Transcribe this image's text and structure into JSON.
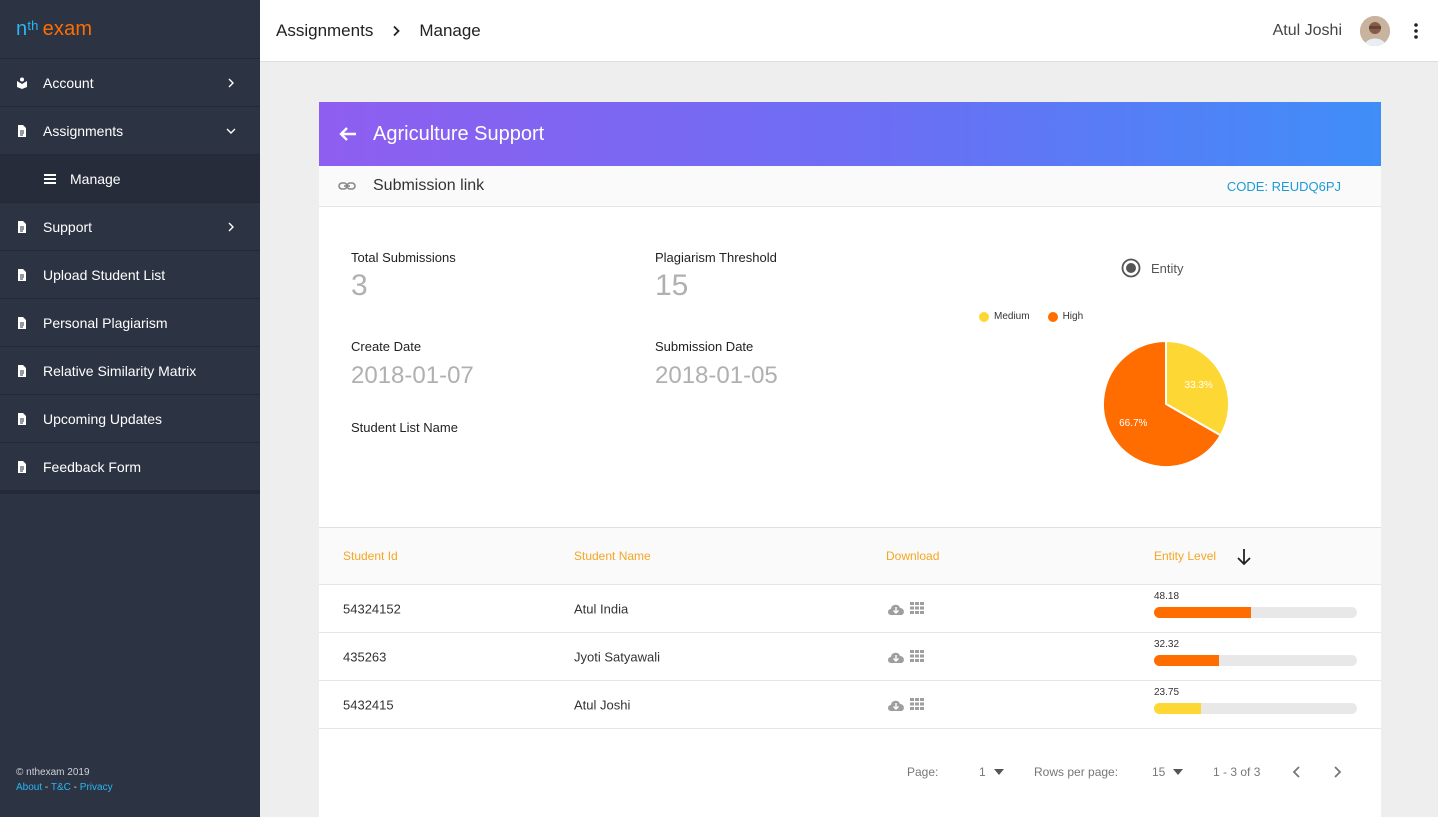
{
  "logo": {
    "n": "n",
    "th": "th",
    "exam": "exam"
  },
  "sidebar": {
    "items": [
      {
        "label": "Account"
      },
      {
        "label": "Assignments"
      },
      {
        "label": "Manage"
      },
      {
        "label": "Support"
      },
      {
        "label": "Upload Student List"
      },
      {
        "label": "Personal Plagiarism"
      },
      {
        "label": "Relative Similarity Matrix"
      },
      {
        "label": "Upcoming Updates"
      },
      {
        "label": "Feedback Form"
      }
    ],
    "footer": {
      "copyright": "© nthexam 2019",
      "about": "About",
      "tc": "T&C",
      "privacy": "Privacy",
      "sep": "-"
    }
  },
  "header": {
    "breadcrumb": [
      "Assignments",
      "Manage"
    ],
    "user_name": "Atul Joshi"
  },
  "card": {
    "title": "Agriculture Support",
    "submission_link_label": "Submission link",
    "code": "CODE: REUDQ6PJ",
    "fields": {
      "total_submissions_label": "Total Submissions",
      "total_submissions": "3",
      "threshold_label": "Plagiarism Threshold",
      "threshold": "15",
      "create_date_label": "Create Date",
      "create_date": "2018-01-07",
      "submission_date_label": "Submission Date",
      "submission_date": "2018-01-05",
      "student_list_label": "Student List Name"
    },
    "radio_label": "Entity"
  },
  "chart_data": {
    "type": "pie",
    "categories": [
      "Medium",
      "High"
    ],
    "values": [
      33.3,
      66.7
    ],
    "labels": [
      "33.3%",
      "66.7%"
    ],
    "colors": [
      "#fdd835",
      "#ff6d00"
    ],
    "legend": "top-left"
  },
  "table": {
    "headers": {
      "id": "Student Id",
      "name": "Student Name",
      "download": "Download",
      "level": "Entity Level"
    },
    "rows": [
      {
        "id": "54324152",
        "name": "Atul India",
        "level": "48.18",
        "fraction": 0.48,
        "color": "#ff6d00"
      },
      {
        "id": "435263",
        "name": "Jyoti Satyawali",
        "level": "32.32",
        "fraction": 0.32,
        "color": "#ff6d00"
      },
      {
        "id": "5432415",
        "name": "Atul Joshi",
        "level": "23.75",
        "fraction": 0.23,
        "color": "#fdd835"
      }
    ]
  },
  "pager": {
    "page_label": "Page:",
    "page": "1",
    "rows_label": "Rows per page:",
    "rows": "15",
    "range": "1 - 3 of 3"
  },
  "colors": {
    "accent": "#f5a623",
    "link": "#1e9bd7",
    "sidebar": "#2c3342"
  }
}
